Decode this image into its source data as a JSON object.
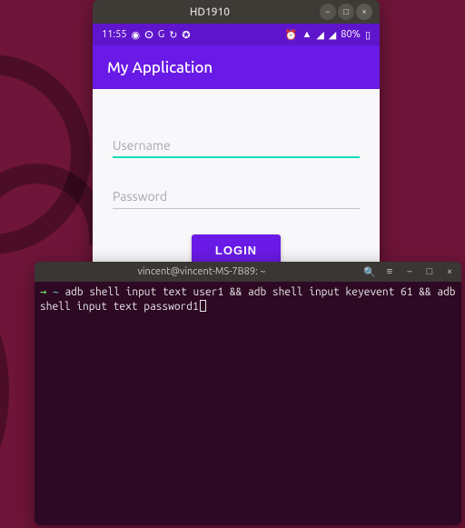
{
  "desktop": {
    "background": "#6f1539"
  },
  "emulator_window": {
    "title": "HD1910",
    "controls": {
      "minimize": "−",
      "maximize": "□",
      "close": "×"
    },
    "status_bar": {
      "time": "11:55",
      "left_icons": [
        "messenger-icon",
        "opera-icon",
        "g-icon",
        "sync-icon",
        "alt-icon"
      ],
      "right_icons": [
        "alarm-icon",
        "wifi-icon",
        "signal-icon",
        "signal-icon-2"
      ],
      "battery": "80%",
      "battery_icon": "battery-icon"
    },
    "app_bar": {
      "title": "My Application"
    },
    "form": {
      "username": {
        "placeholder": "Username",
        "value": "",
        "focused": true
      },
      "password": {
        "placeholder": "Password",
        "value": "",
        "focused": false
      },
      "login_label": "LOGIN"
    }
  },
  "terminal_window": {
    "title": "vincent@vincent-MS-7B89: ~",
    "toolbar_icons": [
      "search-icon",
      "menu-icon"
    ],
    "controls": {
      "minimize": "−",
      "maximize": "□",
      "close": "×"
    },
    "prompt": {
      "arrow": "→",
      "cwd": "~"
    },
    "command": "adb shell input text user1 && adb shell input keyevent 61 && adb shell input text password1"
  }
}
